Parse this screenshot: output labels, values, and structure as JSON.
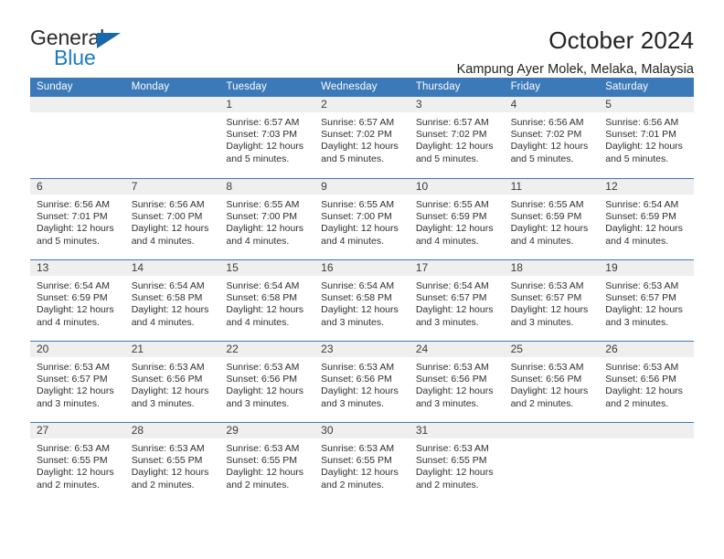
{
  "logo": {
    "primary_text": "General",
    "secondary_text": "Blue",
    "primary_color": "#2b2b2b",
    "secondary_color": "#1a7cc4",
    "triangle_color": "#1769ad",
    "triangle_icon": "triangle-icon"
  },
  "header": {
    "title": "October 2024",
    "subtitle": "Kampung Ayer Molek, Melaka, Malaysia"
  },
  "theme": {
    "header_blue": "#3b79b8",
    "day_band_gray": "#efefef",
    "text_dark": "#2e2e2e"
  },
  "weekday_headers": [
    "Sunday",
    "Monday",
    "Tuesday",
    "Wednesday",
    "Thursday",
    "Friday",
    "Saturday"
  ],
  "weeks": [
    [
      {
        "day": "",
        "sunrise": "",
        "sunset": "",
        "daylight_line1": "",
        "daylight_line2": ""
      },
      {
        "day": "",
        "sunrise": "",
        "sunset": "",
        "daylight_line1": "",
        "daylight_line2": ""
      },
      {
        "day": "1",
        "sunrise": "Sunrise: 6:57 AM",
        "sunset": "Sunset: 7:03 PM",
        "daylight_line1": "Daylight: 12 hours",
        "daylight_line2": "and 5 minutes."
      },
      {
        "day": "2",
        "sunrise": "Sunrise: 6:57 AM",
        "sunset": "Sunset: 7:02 PM",
        "daylight_line1": "Daylight: 12 hours",
        "daylight_line2": "and 5 minutes."
      },
      {
        "day": "3",
        "sunrise": "Sunrise: 6:57 AM",
        "sunset": "Sunset: 7:02 PM",
        "daylight_line1": "Daylight: 12 hours",
        "daylight_line2": "and 5 minutes."
      },
      {
        "day": "4",
        "sunrise": "Sunrise: 6:56 AM",
        "sunset": "Sunset: 7:02 PM",
        "daylight_line1": "Daylight: 12 hours",
        "daylight_line2": "and 5 minutes."
      },
      {
        "day": "5",
        "sunrise": "Sunrise: 6:56 AM",
        "sunset": "Sunset: 7:01 PM",
        "daylight_line1": "Daylight: 12 hours",
        "daylight_line2": "and 5 minutes."
      }
    ],
    [
      {
        "day": "6",
        "sunrise": "Sunrise: 6:56 AM",
        "sunset": "Sunset: 7:01 PM",
        "daylight_line1": "Daylight: 12 hours",
        "daylight_line2": "and 5 minutes."
      },
      {
        "day": "7",
        "sunrise": "Sunrise: 6:56 AM",
        "sunset": "Sunset: 7:00 PM",
        "daylight_line1": "Daylight: 12 hours",
        "daylight_line2": "and 4 minutes."
      },
      {
        "day": "8",
        "sunrise": "Sunrise: 6:55 AM",
        "sunset": "Sunset: 7:00 PM",
        "daylight_line1": "Daylight: 12 hours",
        "daylight_line2": "and 4 minutes."
      },
      {
        "day": "9",
        "sunrise": "Sunrise: 6:55 AM",
        "sunset": "Sunset: 7:00 PM",
        "daylight_line1": "Daylight: 12 hours",
        "daylight_line2": "and 4 minutes."
      },
      {
        "day": "10",
        "sunrise": "Sunrise: 6:55 AM",
        "sunset": "Sunset: 6:59 PM",
        "daylight_line1": "Daylight: 12 hours",
        "daylight_line2": "and 4 minutes."
      },
      {
        "day": "11",
        "sunrise": "Sunrise: 6:55 AM",
        "sunset": "Sunset: 6:59 PM",
        "daylight_line1": "Daylight: 12 hours",
        "daylight_line2": "and 4 minutes."
      },
      {
        "day": "12",
        "sunrise": "Sunrise: 6:54 AM",
        "sunset": "Sunset: 6:59 PM",
        "daylight_line1": "Daylight: 12 hours",
        "daylight_line2": "and 4 minutes."
      }
    ],
    [
      {
        "day": "13",
        "sunrise": "Sunrise: 6:54 AM",
        "sunset": "Sunset: 6:59 PM",
        "daylight_line1": "Daylight: 12 hours",
        "daylight_line2": "and 4 minutes."
      },
      {
        "day": "14",
        "sunrise": "Sunrise: 6:54 AM",
        "sunset": "Sunset: 6:58 PM",
        "daylight_line1": "Daylight: 12 hours",
        "daylight_line2": "and 4 minutes."
      },
      {
        "day": "15",
        "sunrise": "Sunrise: 6:54 AM",
        "sunset": "Sunset: 6:58 PM",
        "daylight_line1": "Daylight: 12 hours",
        "daylight_line2": "and 4 minutes."
      },
      {
        "day": "16",
        "sunrise": "Sunrise: 6:54 AM",
        "sunset": "Sunset: 6:58 PM",
        "daylight_line1": "Daylight: 12 hours",
        "daylight_line2": "and 3 minutes."
      },
      {
        "day": "17",
        "sunrise": "Sunrise: 6:54 AM",
        "sunset": "Sunset: 6:57 PM",
        "daylight_line1": "Daylight: 12 hours",
        "daylight_line2": "and 3 minutes."
      },
      {
        "day": "18",
        "sunrise": "Sunrise: 6:53 AM",
        "sunset": "Sunset: 6:57 PM",
        "daylight_line1": "Daylight: 12 hours",
        "daylight_line2": "and 3 minutes."
      },
      {
        "day": "19",
        "sunrise": "Sunrise: 6:53 AM",
        "sunset": "Sunset: 6:57 PM",
        "daylight_line1": "Daylight: 12 hours",
        "daylight_line2": "and 3 minutes."
      }
    ],
    [
      {
        "day": "20",
        "sunrise": "Sunrise: 6:53 AM",
        "sunset": "Sunset: 6:57 PM",
        "daylight_line1": "Daylight: 12 hours",
        "daylight_line2": "and 3 minutes."
      },
      {
        "day": "21",
        "sunrise": "Sunrise: 6:53 AM",
        "sunset": "Sunset: 6:56 PM",
        "daylight_line1": "Daylight: 12 hours",
        "daylight_line2": "and 3 minutes."
      },
      {
        "day": "22",
        "sunrise": "Sunrise: 6:53 AM",
        "sunset": "Sunset: 6:56 PM",
        "daylight_line1": "Daylight: 12 hours",
        "daylight_line2": "and 3 minutes."
      },
      {
        "day": "23",
        "sunrise": "Sunrise: 6:53 AM",
        "sunset": "Sunset: 6:56 PM",
        "daylight_line1": "Daylight: 12 hours",
        "daylight_line2": "and 3 minutes."
      },
      {
        "day": "24",
        "sunrise": "Sunrise: 6:53 AM",
        "sunset": "Sunset: 6:56 PM",
        "daylight_line1": "Daylight: 12 hours",
        "daylight_line2": "and 3 minutes."
      },
      {
        "day": "25",
        "sunrise": "Sunrise: 6:53 AM",
        "sunset": "Sunset: 6:56 PM",
        "daylight_line1": "Daylight: 12 hours",
        "daylight_line2": "and 2 minutes."
      },
      {
        "day": "26",
        "sunrise": "Sunrise: 6:53 AM",
        "sunset": "Sunset: 6:56 PM",
        "daylight_line1": "Daylight: 12 hours",
        "daylight_line2": "and 2 minutes."
      }
    ],
    [
      {
        "day": "27",
        "sunrise": "Sunrise: 6:53 AM",
        "sunset": "Sunset: 6:55 PM",
        "daylight_line1": "Daylight: 12 hours",
        "daylight_line2": "and 2 minutes."
      },
      {
        "day": "28",
        "sunrise": "Sunrise: 6:53 AM",
        "sunset": "Sunset: 6:55 PM",
        "daylight_line1": "Daylight: 12 hours",
        "daylight_line2": "and 2 minutes."
      },
      {
        "day": "29",
        "sunrise": "Sunrise: 6:53 AM",
        "sunset": "Sunset: 6:55 PM",
        "daylight_line1": "Daylight: 12 hours",
        "daylight_line2": "and 2 minutes."
      },
      {
        "day": "30",
        "sunrise": "Sunrise: 6:53 AM",
        "sunset": "Sunset: 6:55 PM",
        "daylight_line1": "Daylight: 12 hours",
        "daylight_line2": "and 2 minutes."
      },
      {
        "day": "31",
        "sunrise": "Sunrise: 6:53 AM",
        "sunset": "Sunset: 6:55 PM",
        "daylight_line1": "Daylight: 12 hours",
        "daylight_line2": "and 2 minutes."
      },
      {
        "day": "",
        "sunrise": "",
        "sunset": "",
        "daylight_line1": "",
        "daylight_line2": ""
      },
      {
        "day": "",
        "sunrise": "",
        "sunset": "",
        "daylight_line1": "",
        "daylight_line2": ""
      }
    ]
  ]
}
